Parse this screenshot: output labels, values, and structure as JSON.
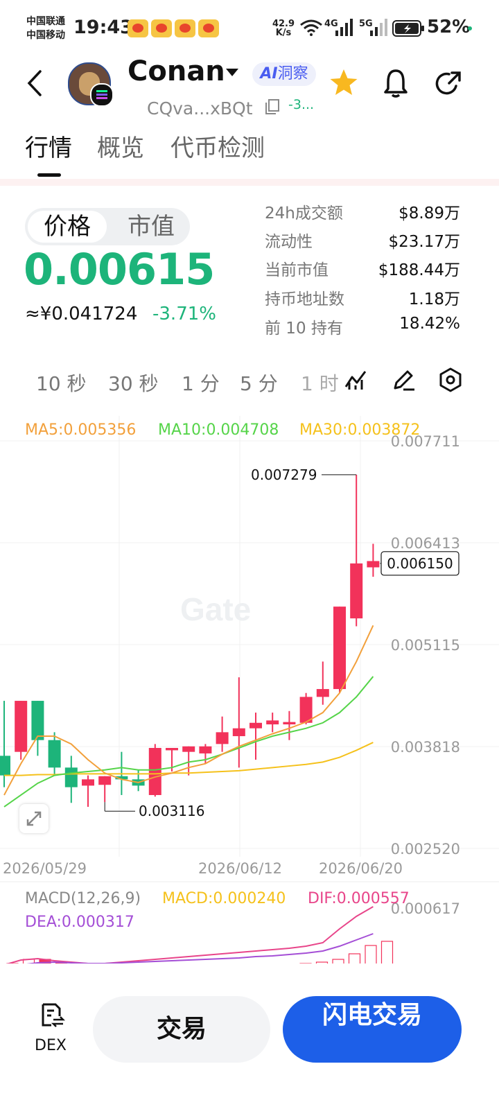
{
  "status_bar": {
    "carrier1": "中国联通",
    "carrier2": "中国移动",
    "time": "19:43",
    "net_speed_value": "42.9",
    "net_speed_unit": "K/s",
    "signal1": "4G",
    "signal2": "5G",
    "battery": "52%"
  },
  "header": {
    "token_name": "Conan",
    "ai_badge": "洞察",
    "ai_badge_prefix": "AI",
    "address": "CQva...xBQt",
    "address_change": "-3..."
  },
  "tabs": [
    {
      "label": "行情"
    },
    {
      "label": "概览"
    },
    {
      "label": "代币检测"
    }
  ],
  "price_panel": {
    "toggle": [
      "价格",
      "市值"
    ],
    "price": "0.00615",
    "cny_price": "≈¥0.041724",
    "change": "-3.71%"
  },
  "stats": [
    {
      "label": "24h成交额",
      "value": "$8.89万"
    },
    {
      "label": "流动性",
      "value": "$23.17万"
    },
    {
      "label": "当前市值",
      "value": "$188.44万"
    },
    {
      "label": "持币地址数",
      "value": "1.18万"
    },
    {
      "label": "前 10 持有",
      "value": "18.42%"
    }
  ],
  "intervals": [
    "10 秒",
    "30 秒",
    "1 分",
    "5 分",
    "1 时"
  ],
  "chart_data": {
    "type": "candlestick",
    "ma_labels": {
      "ma5": "MA5:0.005356",
      "ma10": "MA10:0.004708",
      "ma30": "MA30:0.003872"
    },
    "colors": {
      "up": "#f2325a",
      "down": "#1db47a",
      "ma5": "#f2a03b",
      "ma10": "#55d449",
      "ma30": "#f5c11b"
    },
    "y_ticks": [
      "0.007711",
      "0.006413",
      "0.005115",
      "0.003818",
      "0.002520"
    ],
    "y_range": [
      0.00252,
      0.007711
    ],
    "x_labels": [
      "2026/05/29",
      "2026/06/12",
      "2026/06/20"
    ],
    "high_label": "0.007279",
    "low_label": "0.003116",
    "current_price_label": "0.006150",
    "candles": [
      {
        "o": 0.0037,
        "c": 0.00345,
        "h": 0.0044,
        "l": 0.0033
      },
      {
        "o": 0.00375,
        "c": 0.0044,
        "h": 0.0044,
        "l": 0.00365
      },
      {
        "o": 0.0044,
        "c": 0.0039,
        "h": 0.0044,
        "l": 0.0037
      },
      {
        "o": 0.0039,
        "c": 0.00355,
        "h": 0.004,
        "l": 0.00345
      },
      {
        "o": 0.00355,
        "c": 0.0033,
        "h": 0.0037,
        "l": 0.0031
      },
      {
        "o": 0.00332,
        "c": 0.0034,
        "h": 0.00345,
        "l": 0.00305
      },
      {
        "o": 0.00333,
        "c": 0.00344,
        "h": 0.00344,
        "l": 0.00311
      },
      {
        "o": 0.00344,
        "c": 0.0034,
        "h": 0.00375,
        "l": 0.0032
      },
      {
        "o": 0.0034,
        "c": 0.00332,
        "h": 0.00352,
        "l": 0.00325
      },
      {
        "o": 0.0032,
        "c": 0.0038,
        "h": 0.00385,
        "l": 0.00318
      },
      {
        "o": 0.00377,
        "c": 0.0038,
        "h": 0.0038,
        "l": 0.0035
      },
      {
        "o": 0.00375,
        "c": 0.00382,
        "h": 0.00382,
        "l": 0.00345
      },
      {
        "o": 0.00373,
        "c": 0.00382,
        "h": 0.00385,
        "l": 0.0036
      },
      {
        "o": 0.00385,
        "c": 0.004,
        "h": 0.0042,
        "l": 0.00375
      },
      {
        "o": 0.00395,
        "c": 0.00405,
        "h": 0.0047,
        "l": 0.00355
      },
      {
        "o": 0.00405,
        "c": 0.00412,
        "h": 0.00425,
        "l": 0.00365
      },
      {
        "o": 0.0041,
        "c": 0.00415,
        "h": 0.00425,
        "l": 0.004
      },
      {
        "o": 0.0041,
        "c": 0.00413,
        "h": 0.00427,
        "l": 0.0039
      },
      {
        "o": 0.00412,
        "c": 0.00445,
        "h": 0.0045,
        "l": 0.0041
      },
      {
        "o": 0.00445,
        "c": 0.00455,
        "h": 0.0049,
        "l": 0.00435
      },
      {
        "o": 0.00455,
        "c": 0.0056,
        "h": 0.0056,
        "l": 0.0045
      },
      {
        "o": 0.00545,
        "c": 0.00615,
        "h": 0.00728,
        "l": 0.00535
      },
      {
        "o": 0.0061,
        "c": 0.00618,
        "h": 0.0064,
        "l": 0.00598
      }
    ],
    "ma5_line": [
      0.0032,
      0.0036,
      0.00395,
      0.00395,
      0.00385,
      0.00365,
      0.00348,
      0.0034,
      0.00336,
      0.00343,
      0.00348,
      0.00355,
      0.0036,
      0.00372,
      0.00382,
      0.0039,
      0.00398,
      0.00405,
      0.00413,
      0.00425,
      0.0045,
      0.0049,
      0.00536
    ],
    "ma10_line": [
      0.00305,
      0.0032,
      0.00335,
      0.00345,
      0.00348,
      0.0035,
      0.00352,
      0.00355,
      0.00352,
      0.00352,
      0.00355,
      0.00362,
      0.00365,
      0.00372,
      0.0038,
      0.00388,
      0.00395,
      0.004,
      0.00405,
      0.00412,
      0.00425,
      0.00445,
      0.00471
    ],
    "ma30_line": [
      0.00345,
      0.00345,
      0.00346,
      0.00346,
      0.00347,
      0.00347,
      0.00347,
      0.00347,
      0.00347,
      0.00347,
      0.00348,
      0.00348,
      0.00349,
      0.0035,
      0.00351,
      0.00353,
      0.00355,
      0.00357,
      0.00359,
      0.00362,
      0.00368,
      0.00377,
      0.00387
    ],
    "macd": {
      "label": "MACD(12,26,9)",
      "macd_value": "MACD:0.000240",
      "dif_value": "DIF:0.000557",
      "dea_value": "DEA:0.000317",
      "y_tick_top": "0.000617"
    }
  },
  "bottom_bar": {
    "dex_label": "DEX",
    "trade_label": "交易",
    "flash_trade_label": "闪电交易"
  }
}
